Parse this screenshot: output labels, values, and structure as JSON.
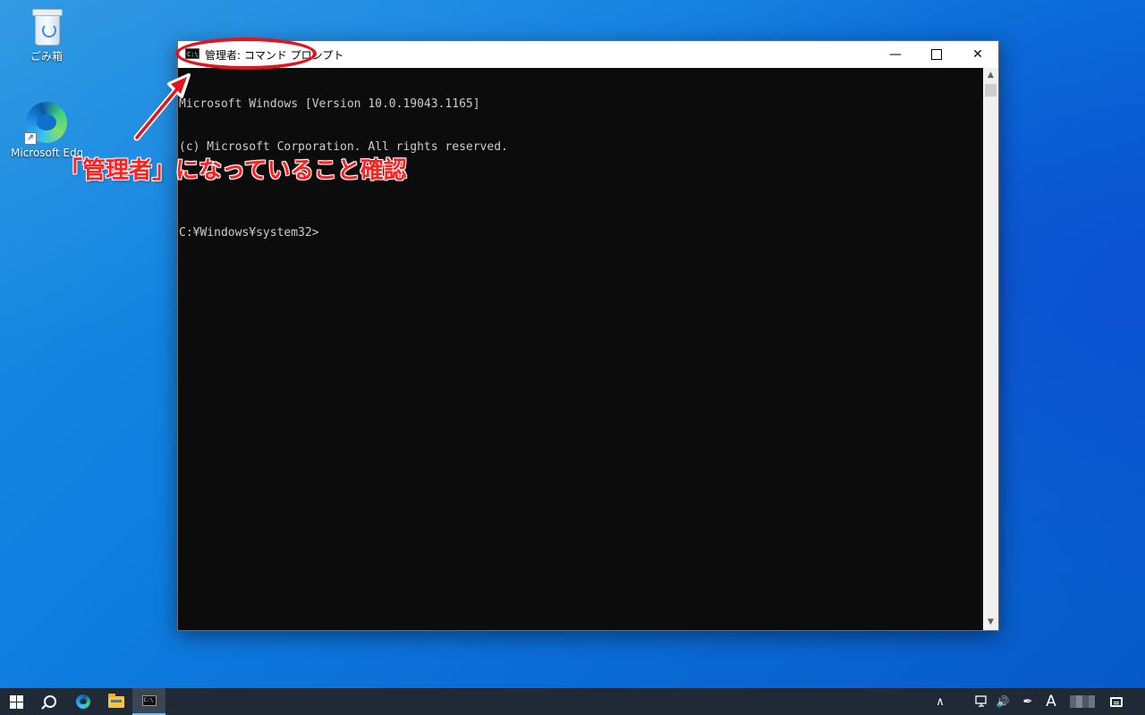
{
  "desktop": {
    "icons": [
      {
        "label": "ごみ箱",
        "icon": "recycle-bin-icon"
      },
      {
        "label": "Microsoft Edge",
        "icon": "edge-icon"
      }
    ]
  },
  "window": {
    "title": "管理者: コマンド プロンプト",
    "app_icon_text": "C:\\.",
    "controls": {
      "minimize": "—",
      "close": "✕"
    },
    "console_lines": [
      "Microsoft Windows [Version 10.0.19043.1165]",
      "(c) Microsoft Corporation. All rights reserved.",
      "",
      "C:¥Windows¥system32>"
    ]
  },
  "annotation": {
    "text": "「管理者」になっていること確認",
    "color": "#e3141c"
  },
  "taskbar": {
    "buttons": [
      "start-icon",
      "search-icon",
      "edge-icon",
      "file-explorer-icon",
      "cmd-icon"
    ],
    "tray": {
      "chevron": "∧",
      "volume": "🔊",
      "pen": "✒",
      "ime": "A"
    }
  }
}
